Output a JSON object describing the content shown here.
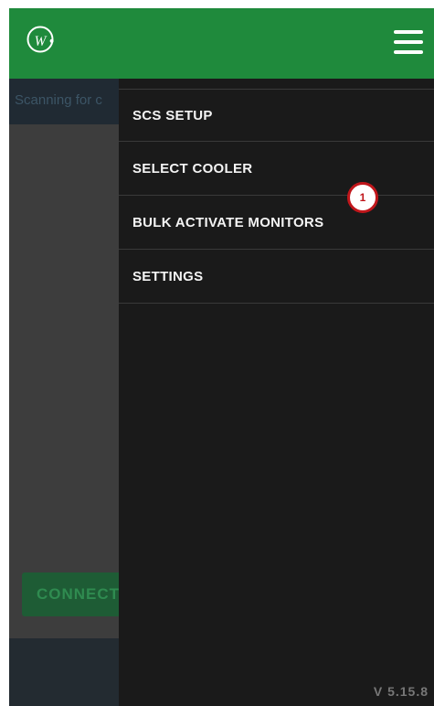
{
  "header": {
    "logo_letter": "W",
    "menu_icon": "hamburger-menu-icon",
    "bg_color": "#1f8a3c"
  },
  "background": {
    "status_text": "Scanning for c",
    "connect_label": "CONNECT"
  },
  "drawer": {
    "items": [
      {
        "label": "SCS SETUP"
      },
      {
        "label": "SELECT COOLER"
      },
      {
        "label": "BULK ACTIVATE MONITORS"
      },
      {
        "label": "SETTINGS"
      }
    ],
    "badge": "1",
    "badge_color": "#c0161b",
    "version": "V 5.15.8"
  }
}
